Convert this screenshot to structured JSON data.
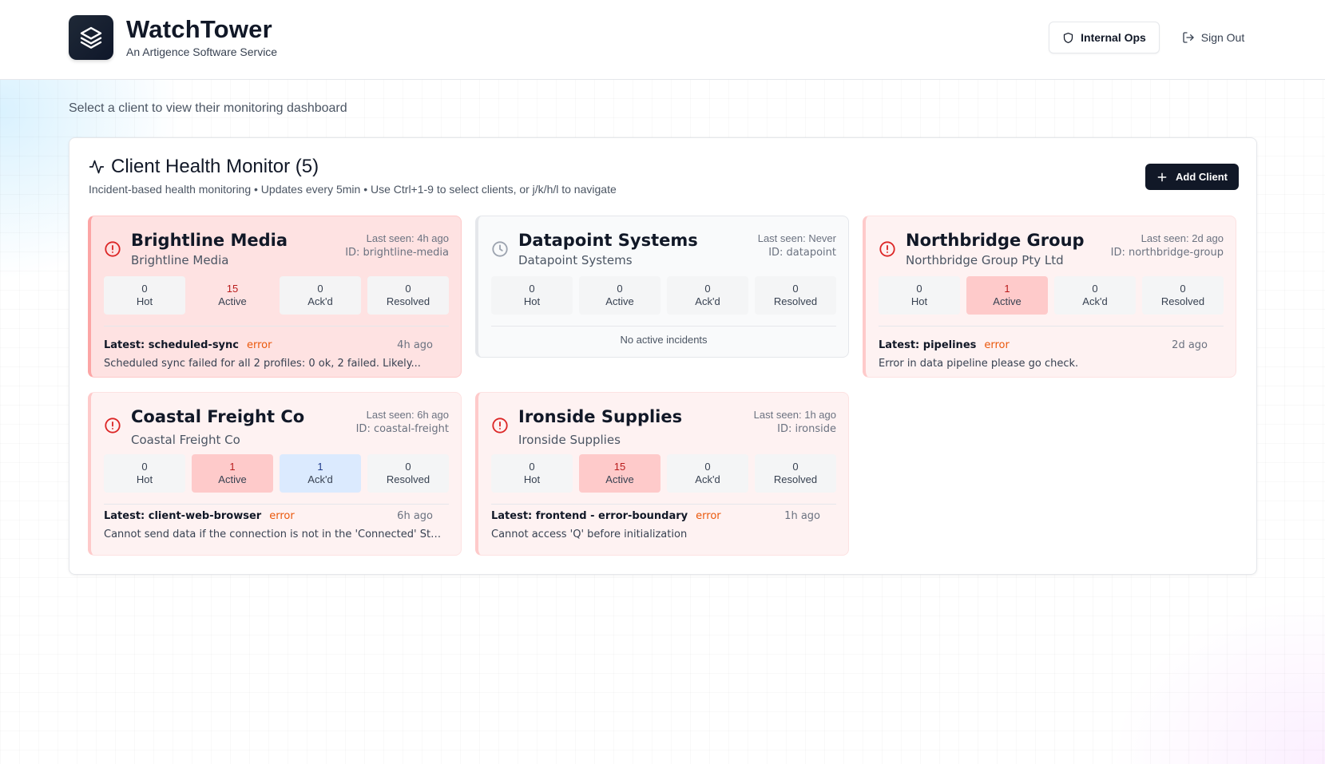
{
  "app": {
    "title": "WatchTower",
    "subtitle": "An Artigence Software Service",
    "logo_icon": "layers-icon"
  },
  "header": {
    "ops_label": "Internal Ops",
    "ops_icon": "shield-icon",
    "signout_label": "Sign Out",
    "signout_icon": "log-out-icon"
  },
  "page": {
    "hint": "Select a client to view their monitoring dashboard"
  },
  "panel": {
    "title": "Client Health Monitor (5)",
    "subtitle": "Incident-based health monitoring • Updates every 5min • Use Ctrl+1-9 to select clients, or j/k/h/l to navigate",
    "add_label": "Add Client"
  },
  "colors": {
    "accent_dark": "#111827",
    "alert_red": "#dc2626",
    "severity_orange": "#ea580c",
    "ack_blue": "#dbeafe"
  },
  "clients": [
    {
      "name": "Brightline Media",
      "org": "Brightline Media",
      "last_seen": "Last seen: 4h ago",
      "id_text": "ID: brightline-media",
      "status_icon": "alert-circle-icon",
      "stats": {
        "hot": "0",
        "active": "15",
        "ackd": "0",
        "resolved": "0"
      },
      "labels": {
        "hot": "Hot",
        "active": "Active",
        "ackd": "Ack'd",
        "resolved": "Resolved"
      },
      "latest_source": "Latest: scheduled-sync",
      "latest_severity": "error",
      "latest_ago": "4h ago",
      "latest_message": "Scheduled sync failed for all 2 profiles: 0 ok, 2 failed. Likely..."
    },
    {
      "name": "Datapoint Systems",
      "org": "Datapoint Systems",
      "last_seen": "Last seen: Never",
      "id_text": "ID: datapoint",
      "status_icon": "clock-icon",
      "stats": {
        "hot": "0",
        "active": "0",
        "ackd": "0",
        "resolved": "0"
      },
      "labels": {
        "hot": "Hot",
        "active": "Active",
        "ackd": "Ack'd",
        "resolved": "Resolved"
      },
      "no_incidents": "No active incidents"
    },
    {
      "name": "Northbridge Group",
      "org": "Northbridge Group Pty Ltd",
      "last_seen": "Last seen: 2d ago",
      "id_text": "ID: northbridge-group",
      "status_icon": "alert-circle-icon",
      "stats": {
        "hot": "0",
        "active": "1",
        "ackd": "0",
        "resolved": "0"
      },
      "labels": {
        "hot": "Hot",
        "active": "Active",
        "ackd": "Ack'd",
        "resolved": "Resolved"
      },
      "latest_source": "Latest: pipelines",
      "latest_severity": "error",
      "latest_ago": "2d ago",
      "latest_message": "Error in data pipeline please go check."
    },
    {
      "name": "Coastal Freight Co",
      "org": "Coastal Freight Co",
      "last_seen": "Last seen: 6h ago",
      "id_text": "ID: coastal-freight",
      "status_icon": "alert-circle-icon",
      "stats": {
        "hot": "0",
        "active": "1",
        "ackd": "1",
        "resolved": "0"
      },
      "labels": {
        "hot": "Hot",
        "active": "Active",
        "ackd": "Ack'd",
        "resolved": "Resolved"
      },
      "latest_source": "Latest: client-web-browser",
      "latest_severity": "error",
      "latest_ago": "6h ago",
      "latest_message": "Cannot send data if the connection is not in the 'Connected' State."
    },
    {
      "name": "Ironside Supplies",
      "org": "Ironside Supplies",
      "last_seen": "Last seen: 1h ago",
      "id_text": "ID: ironside",
      "status_icon": "alert-circle-icon",
      "stats": {
        "hot": "0",
        "active": "15",
        "ackd": "0",
        "resolved": "0"
      },
      "labels": {
        "hot": "Hot",
        "active": "Active",
        "ackd": "Ack'd",
        "resolved": "Resolved"
      },
      "latest_source": "Latest: frontend - error-boundary",
      "latest_severity": "error",
      "latest_ago": "1h ago",
      "latest_message": "Cannot access 'Q' before initialization"
    }
  ]
}
